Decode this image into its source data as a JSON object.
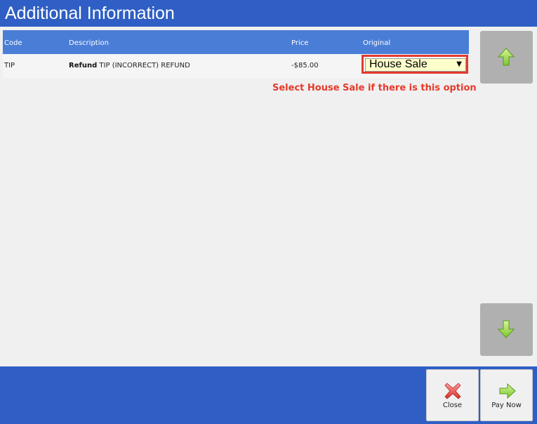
{
  "window": {
    "title": "Additional Information"
  },
  "table": {
    "headers": {
      "code": "Code",
      "description": "Description",
      "price": "Price",
      "original": "Original"
    },
    "rows": [
      {
        "code": "TIP",
        "description_bold": "Refund",
        "description_rest": "TIP (INCORRECT) REFUND",
        "price": "-$85.00",
        "original": "House Sale"
      }
    ]
  },
  "annotation": {
    "text": "Select House Sale if there is this option",
    "color": "#e63a2a"
  },
  "scroll": {
    "up_icon": "arrow-up-icon",
    "down_icon": "arrow-down-icon"
  },
  "footer": {
    "close_label": "Close",
    "pay_now_label": "Pay Now"
  },
  "colors": {
    "brand_blue": "#2f5fc4",
    "header_blue": "#4a7ed6",
    "highlight_red": "#e23a2e"
  }
}
